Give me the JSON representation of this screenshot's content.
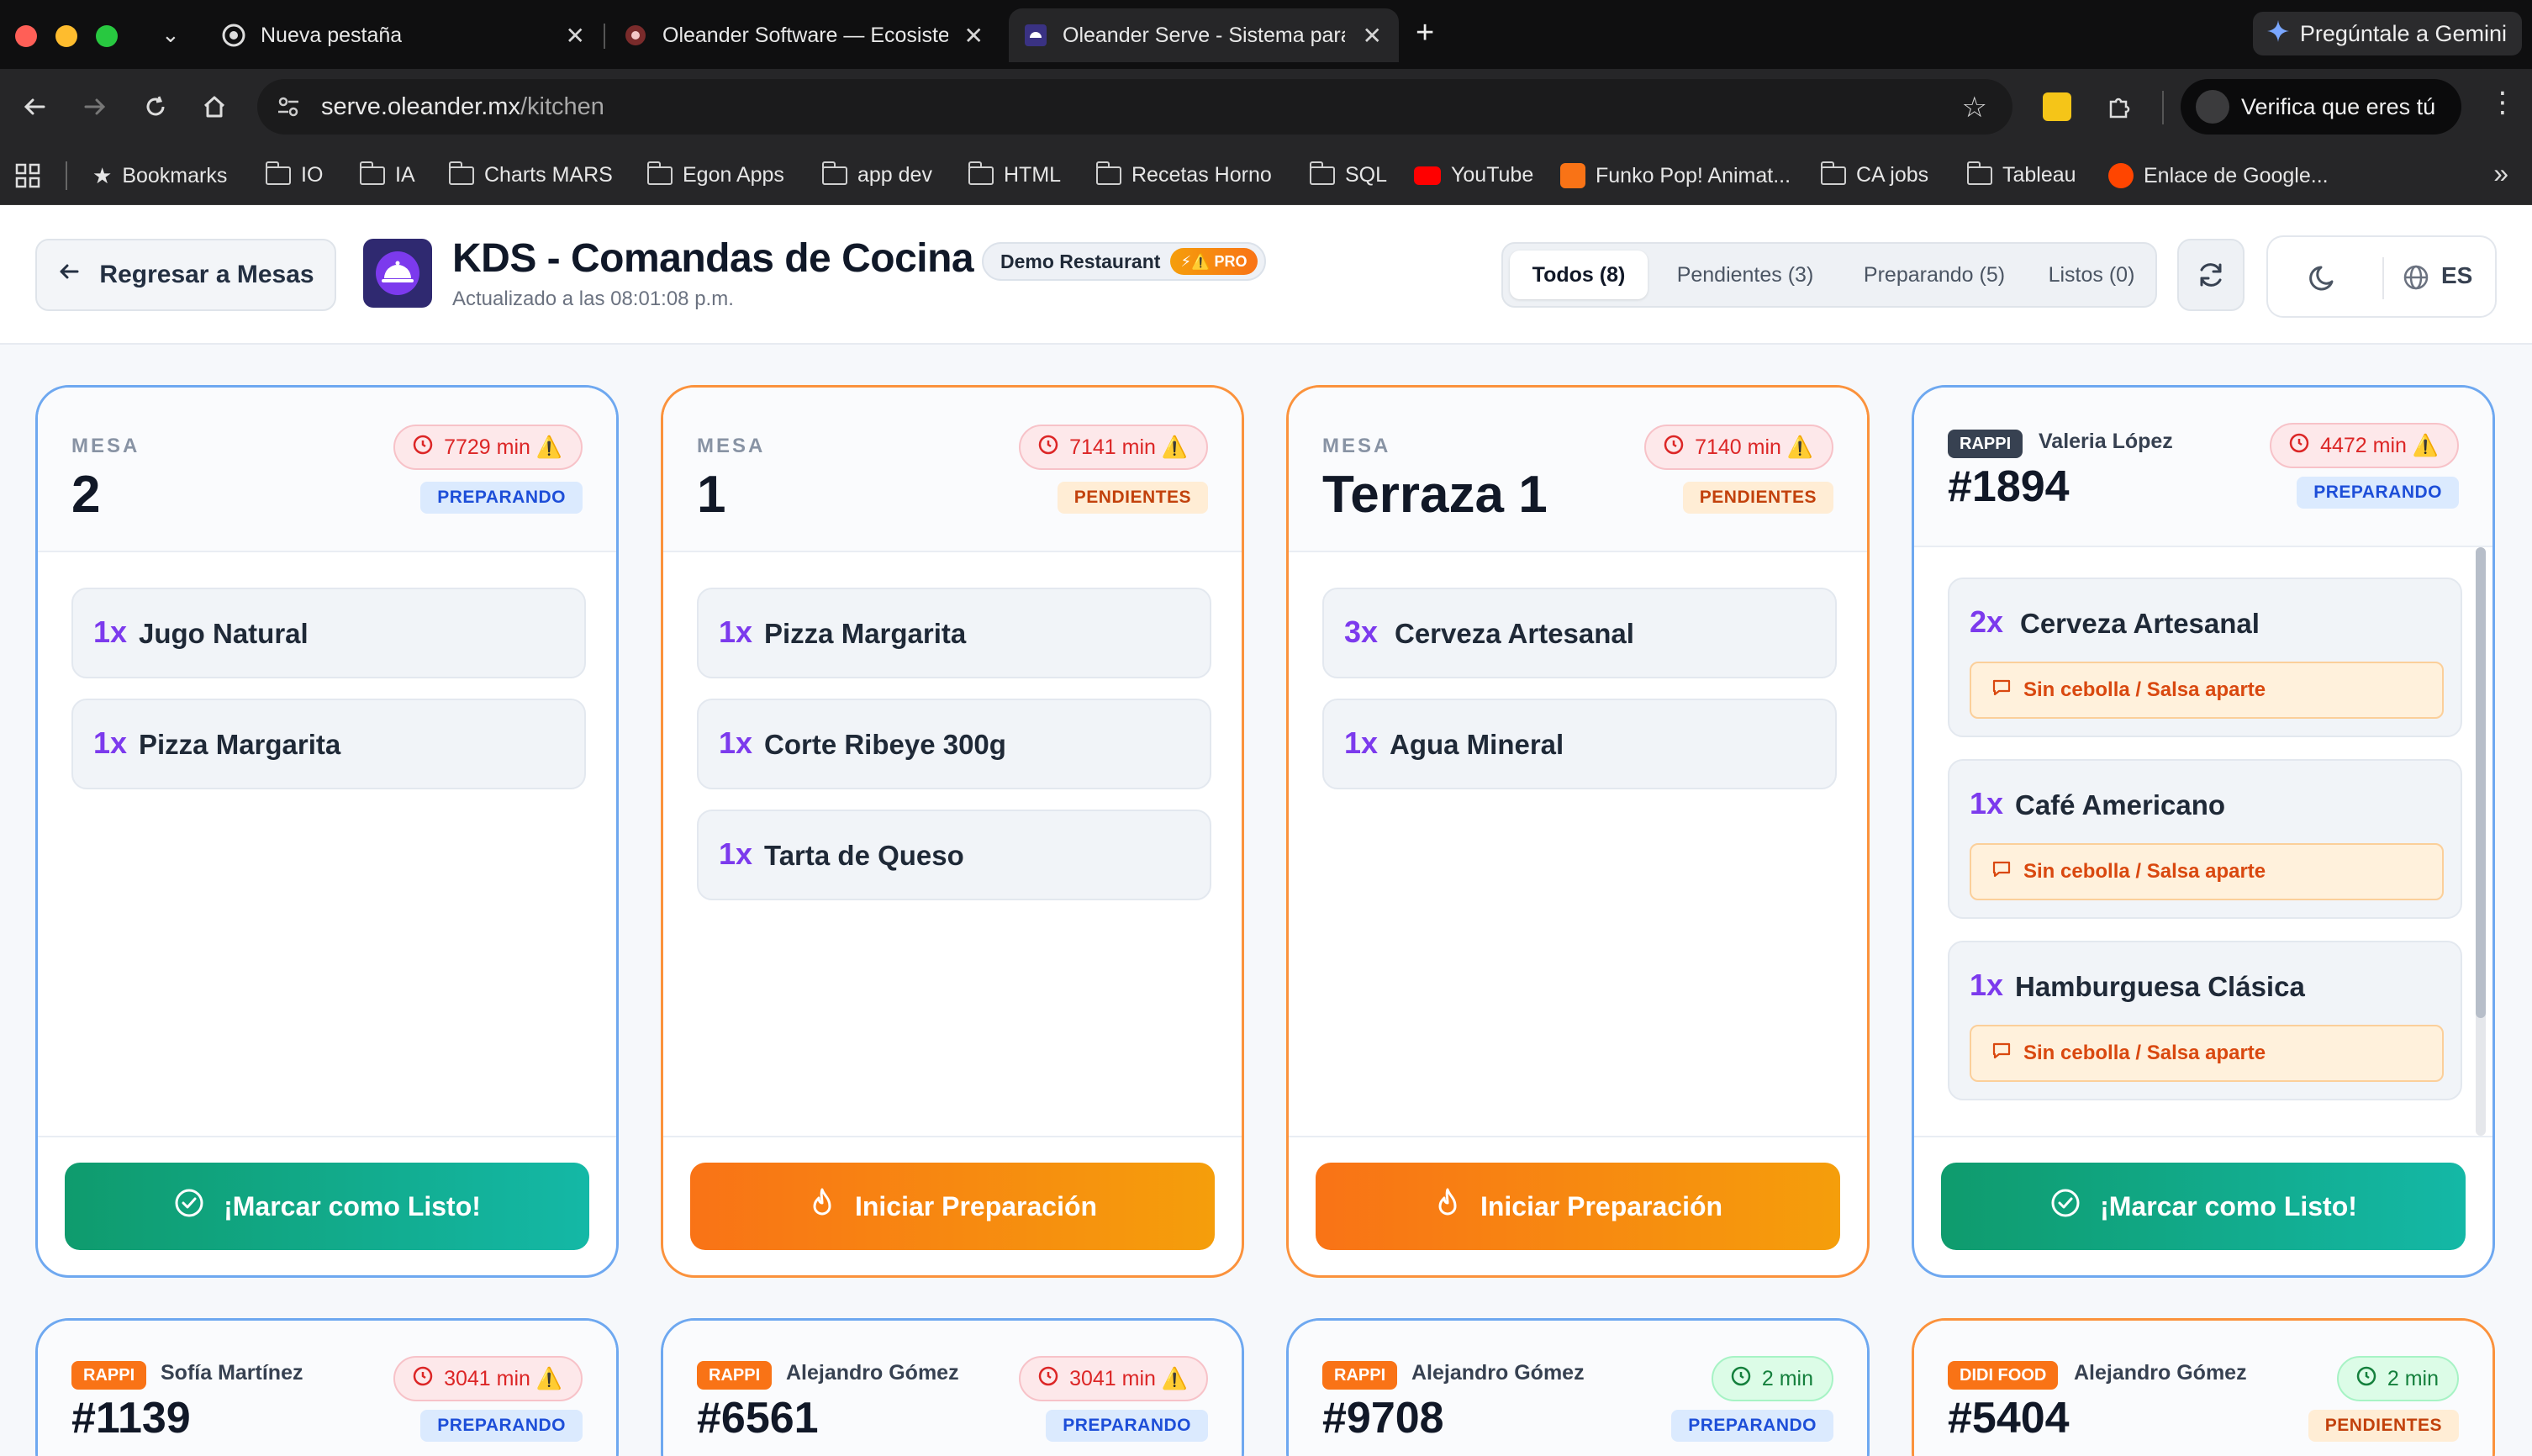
{
  "browser": {
    "tabs": [
      {
        "title": "Nueva pestaña"
      },
      {
        "title": "Oleander Software — Ecosistema"
      },
      {
        "title": "Oleander Serve - Sistema para"
      }
    ],
    "new_tab": "+",
    "gemini": "Pregúntale a Gemini",
    "url_domain": "serve.oleander.mx",
    "url_path": "/kitchen",
    "verify": "Verifica que eres tú",
    "bookmarks": [
      "Bookmarks",
      "IO",
      "IA",
      "Charts MARS",
      "Egon Apps",
      "app dev",
      "HTML",
      "Recetas Horno",
      "SQL",
      "YouTube",
      "Funko Pop! Animat...",
      "CA jobs",
      "Tableau",
      "Enlace de Google..."
    ],
    "more": "»"
  },
  "header": {
    "back": "Regresar a Mesas",
    "title": "KDS - Comandas de Cocina",
    "restaurant": "Demo Restaurant",
    "pro": "⚡⚠️ PRO",
    "updated": "Actualizado a las 08:01:08 p.m.",
    "filters": [
      "Todos (8)",
      "Pendientes (3)",
      "Preparando (5)",
      "Listos (0)"
    ],
    "lang": "ES"
  },
  "cards": [
    {
      "label": "MESA",
      "number": "2",
      "timer": "7729 min ⚠️",
      "status": "PREPARANDO",
      "items": [
        {
          "qty": "1x",
          "name": "Jugo Natural"
        },
        {
          "qty": "1x",
          "name": "Pizza Margarita"
        }
      ],
      "action": "¡Marcar como Listo!"
    },
    {
      "label": "MESA",
      "number": "1",
      "timer": "7141 min ⚠️",
      "status": "PENDIENTES",
      "items": [
        {
          "qty": "1x",
          "name": "Pizza Margarita"
        },
        {
          "qty": "1x",
          "name": "Corte Ribeye 300g"
        },
        {
          "qty": "1x",
          "name": "Tarta de Queso"
        }
      ],
      "action": "Iniciar Preparación"
    },
    {
      "label": "MESA",
      "number": "Terraza 1",
      "timer": "7140 min ⚠️",
      "status": "PENDIENTES",
      "items": [
        {
          "qty": "3x",
          "name": "Cerveza Artesanal"
        },
        {
          "qty": "1x",
          "name": "Agua Mineral"
        }
      ],
      "action": "Iniciar Preparación"
    },
    {
      "platform": "RAPPI",
      "customer": "Valeria López",
      "number": "#1894",
      "timer": "4472 min ⚠️",
      "status": "PREPARANDO",
      "items": [
        {
          "qty": "2x",
          "name": "Cerveza Artesanal",
          "note": "Sin cebolla / Salsa aparte"
        },
        {
          "qty": "1x",
          "name": "Café Americano",
          "note": "Sin cebolla / Salsa aparte"
        },
        {
          "qty": "1x",
          "name": "Hamburguesa Clásica",
          "note": "Sin cebolla / Salsa aparte"
        }
      ],
      "action": "¡Marcar como Listo!"
    },
    {
      "platform": "RAPPI",
      "customer": "Sofía Martínez",
      "number": "#1139",
      "timer": "3041 min ⚠️",
      "status": "PREPARANDO"
    },
    {
      "platform": "RAPPI",
      "customer": "Alejandro Gómez",
      "number": "#6561",
      "timer": "3041 min ⚠️",
      "status": "PREPARANDO"
    },
    {
      "platform": "RAPPI",
      "customer": "Alejandro Gómez",
      "number": "#9708",
      "timer": "2 min",
      "status": "PREPARANDO"
    },
    {
      "platform": "DIDI FOOD",
      "customer": "Alejandro Gómez",
      "number": "#5404",
      "timer": "2 min",
      "status": "PENDIENTES"
    }
  ],
  "colors": {
    "accent_purple": "#7c3aed",
    "ready_green": "#10a37f",
    "start_orange": "#f97316",
    "prep_blue": "#1d4ed8"
  }
}
